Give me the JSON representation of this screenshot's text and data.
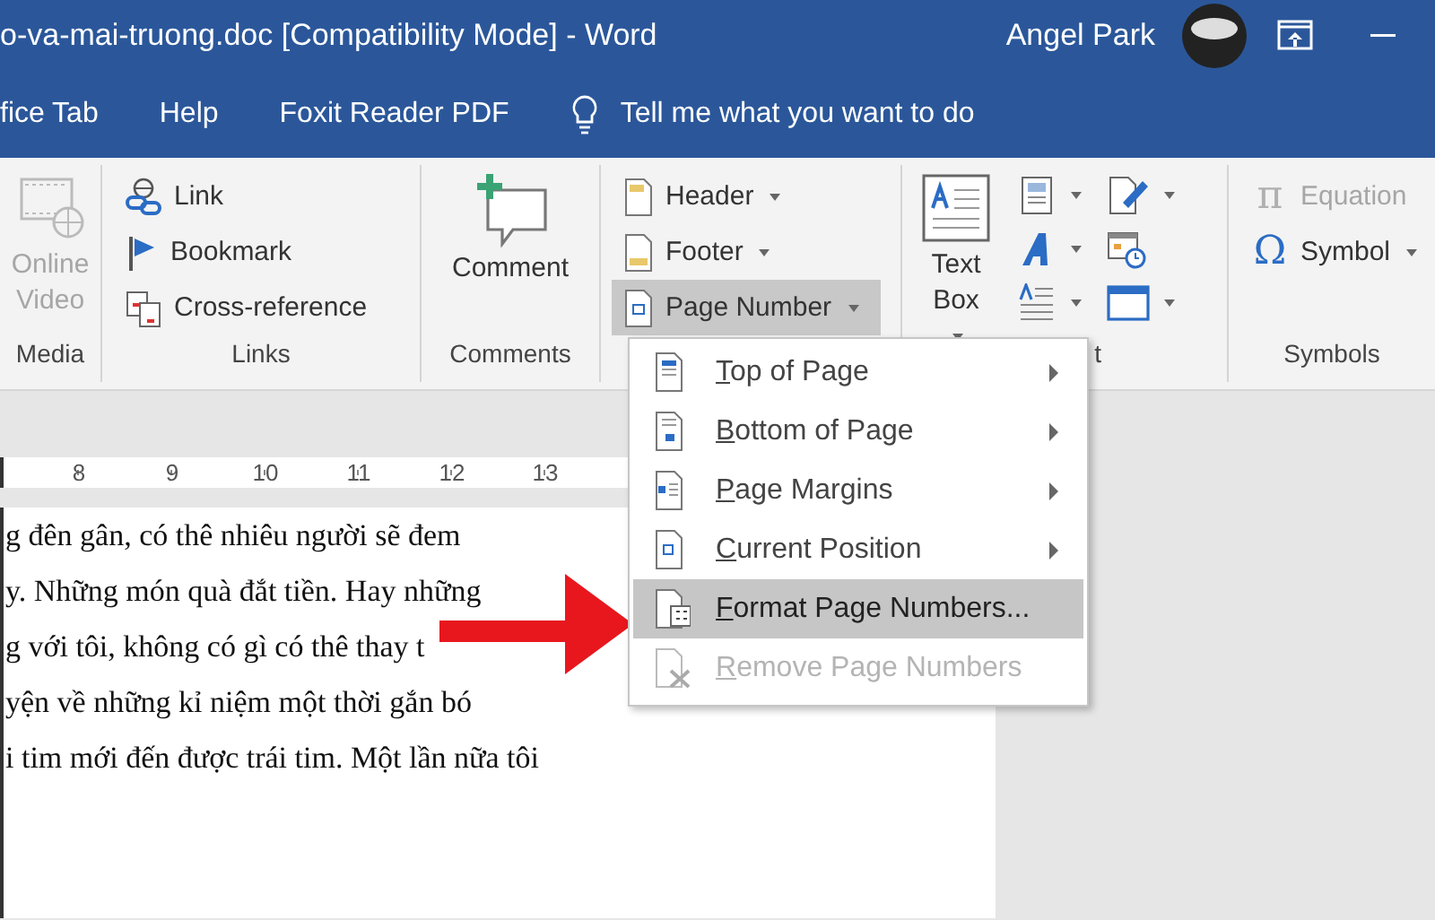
{
  "window": {
    "title": "o-va-mai-truong.doc [Compatibility Mode]  -  Word",
    "user": "Angel Park"
  },
  "tabs": [
    {
      "label": "fice Tab",
      "selected": false
    },
    {
      "label": "Help",
      "selected": false
    },
    {
      "label": "Foxit Reader PDF",
      "selected": false
    }
  ],
  "tell_me": {
    "placeholder": "Tell me what you want to do"
  },
  "ribbon": {
    "groups": [
      {
        "label": "Media",
        "items": [
          {
            "kind": "large",
            "label": "Online Video",
            "disabled": true
          }
        ]
      },
      {
        "label": "Links",
        "items": [
          {
            "kind": "small",
            "label": "Link"
          },
          {
            "kind": "small",
            "label": "Bookmark"
          },
          {
            "kind": "small",
            "label": "Cross-reference"
          }
        ]
      },
      {
        "label": "Comments",
        "items": [
          {
            "kind": "large",
            "label": "Comment"
          }
        ]
      },
      {
        "items": [
          {
            "kind": "small",
            "label": "Header",
            "dropdown": true
          },
          {
            "kind": "small",
            "label": "Footer",
            "dropdown": true
          },
          {
            "kind": "small",
            "label": "Page Number",
            "dropdown": true,
            "pressed": true
          }
        ]
      },
      {
        "label": "t",
        "items": [
          {
            "kind": "large",
            "label": "Text Box",
            "dropdown": true
          },
          {
            "kind": "icon",
            "dropdown": true
          },
          {
            "kind": "icon",
            "dropdown": true
          },
          {
            "kind": "icon",
            "dropdown": true
          },
          {
            "kind": "icon",
            "dropdown": false
          },
          {
            "kind": "icon",
            "dropdown": true
          },
          {
            "kind": "icon",
            "dropdown": true
          }
        ]
      },
      {
        "label": "Symbols",
        "items": [
          {
            "kind": "small",
            "glyph": "π",
            "label": "Equation",
            "disabled": true
          },
          {
            "kind": "small",
            "glyph": "Ω",
            "label": "Symbol",
            "dropdown": true
          }
        ]
      }
    ]
  },
  "ruler": {
    "marks": [
      "8",
      "9",
      "10",
      "11",
      "12",
      "13"
    ]
  },
  "document": {
    "lines": [
      "g đên gân, có thê nhiêu người sẽ đem",
      "y. Những món quà đắt tiền. Hay những",
      "g với tôi, không có gì có thê thay t",
      "yện về những kỉ niệm một thời gắn bó",
      "i tim mới đến được trái tim. Một lần nữa tôi"
    ]
  },
  "menu": {
    "items": [
      {
        "label": "Top of Page",
        "submenu": true,
        "selected": false,
        "disabled": false
      },
      {
        "label": "Bottom of Page",
        "submenu": true,
        "selected": false,
        "disabled": false
      },
      {
        "label": "Page Margins",
        "submenu": true,
        "selected": false,
        "disabled": false
      },
      {
        "label": "Current Position",
        "submenu": true,
        "selected": false,
        "disabled": false
      },
      {
        "label": "Format Page Numbers...",
        "submenu": false,
        "selected": true,
        "disabled": false
      },
      {
        "label": "Remove Page Numbers",
        "submenu": false,
        "selected": false,
        "disabled": true
      }
    ]
  }
}
